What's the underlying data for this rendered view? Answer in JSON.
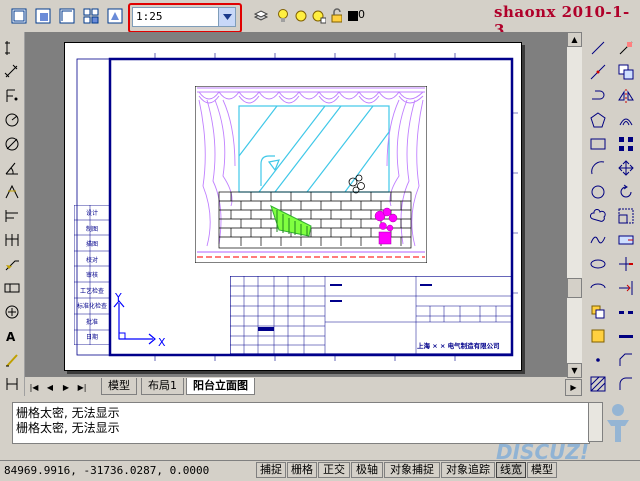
{
  "toolbar": {
    "scale_value": "1:25",
    "layer_name": "0",
    "watermark": "shaonx 2010-1-3"
  },
  "drawing": {
    "ucs_y_label": "Y",
    "ucs_x_label": "X",
    "title_block_company": "上海 × × 电气制造有限公司",
    "side_table_labels": [
      "设计",
      "制图",
      "描图",
      "校对",
      "审核",
      "工艺检查",
      "标准化检查",
      "批准",
      "日期"
    ]
  },
  "tabs": {
    "items": [
      {
        "label": "模型",
        "active": false
      },
      {
        "label": "布局1",
        "active": false
      },
      {
        "label": "阳台立面图",
        "active": true
      }
    ]
  },
  "command": {
    "lines": [
      "栅格太密, 无法显示",
      "栅格太密, 无法显示"
    ]
  },
  "status": {
    "coordinates": "84969.9916, -31736.0287, 0.0000",
    "buttons": [
      "捕捉",
      "栅格",
      "正交",
      "极轴",
      "对象捕捉",
      "对象追踪",
      "线宽",
      "模型"
    ]
  },
  "overlay": {
    "discuz_logo": "DISCUZ!"
  },
  "colors": {
    "highlight_border": "#e00000",
    "watermark": "#b0002a",
    "drawing_line": "#00008b",
    "curtain": "#c080ff",
    "glass": "#40c8e8",
    "plant": "#ff00ff",
    "railing": "#80ff40"
  }
}
